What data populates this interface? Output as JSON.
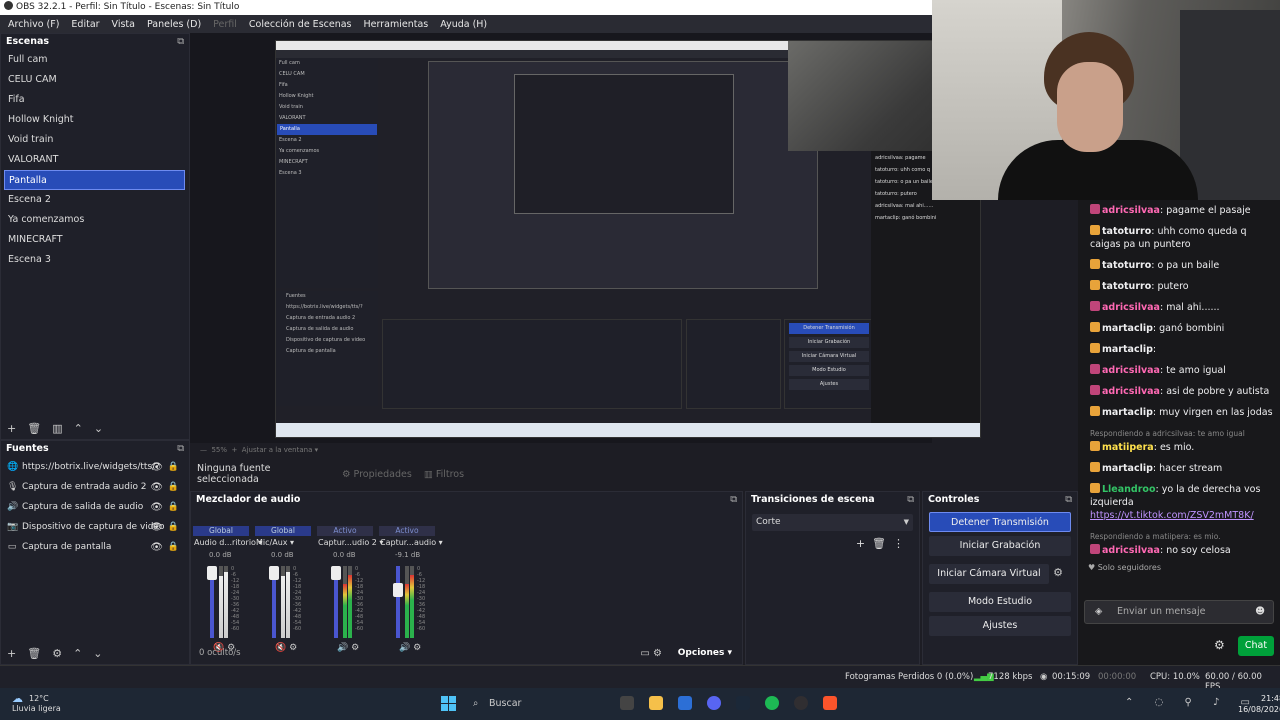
{
  "window": {
    "title": "OBS 32.2.1 - Perfil: Sin Título - Escenas: Sin Título"
  },
  "menu": [
    {
      "label": "Archivo (F)",
      "enabled": true
    },
    {
      "label": "Editar",
      "enabled": true
    },
    {
      "label": "Vista",
      "enabled": true
    },
    {
      "label": "Paneles (D)",
      "enabled": true
    },
    {
      "label": "Perfil",
      "enabled": false
    },
    {
      "label": "Colección de Escenas",
      "enabled": true
    },
    {
      "label": "Herramientas",
      "enabled": true
    },
    {
      "label": "Ayuda (H)",
      "enabled": true
    }
  ],
  "scenes": {
    "title": "Escenas",
    "items": [
      "Full cam",
      "CELU CAM",
      "Fifa",
      "Hollow Knight",
      "Void train",
      "VALORANT",
      "Pantalla",
      "Escena 2",
      "Ya comenzamos",
      "MINECRAFT",
      "Escena 3"
    ],
    "selected": "Pantalla"
  },
  "sources": {
    "title": "Fuentes",
    "items": [
      {
        "label": "https://botrix.live/widgets/tts/?",
        "icon": "globe-icon"
      },
      {
        "label": "Captura de entrada audio 2",
        "icon": "microphone-icon"
      },
      {
        "label": "Captura de salida de audio",
        "icon": "speaker-icon"
      },
      {
        "label": "Dispositivo de captura de video",
        "icon": "camera-icon"
      },
      {
        "label": "Captura de pantalla",
        "icon": "monitor-icon"
      }
    ]
  },
  "preview": {
    "scale_label": "Ajustar a la ventana"
  },
  "context_bar": {
    "no_source": "Ninguna fuente seleccionada",
    "properties": "Propiedades",
    "filters": "Filtros"
  },
  "mixer": {
    "title": "Mezclador de audio",
    "channels": [
      {
        "tag": "Global",
        "name": "Audio d...ritorio",
        "db": "0.0 dB",
        "level": 1.0,
        "muted": true,
        "active": false
      },
      {
        "tag": "Global",
        "name": "Mic/Aux",
        "db": "0.0 dB",
        "level": 1.0,
        "muted": true,
        "active": false
      },
      {
        "tag": "Activo",
        "name": "Captur...udio 2",
        "db": "0.0 dB",
        "level": 1.0,
        "muted": false,
        "active": true
      },
      {
        "tag": "Activo",
        "name": "Captur...audio",
        "db": "-9.1 dB",
        "level": 0.72,
        "muted": false,
        "active": true
      }
    ],
    "scale": [
      "0",
      "-6",
      "-12",
      "-18",
      "-24",
      "-30",
      "-36",
      "-42",
      "-48",
      "-54",
      "-60"
    ],
    "hidden": "0 oculto/s",
    "options": "Opciones"
  },
  "transitions": {
    "title": "Transiciones de escena",
    "selected": "Corte"
  },
  "controls": {
    "title": "Controles",
    "buttons": [
      "Detener Transmisión",
      "Iniciar Grabación",
      "Iniciar Cámara Virtual",
      "Modo Estudio",
      "Ajustes"
    ]
  },
  "chat": {
    "messages": [
      {
        "user": "adricsilvaa",
        "color": "#ff69b4",
        "text": "pagame el pasaje"
      },
      {
        "user": "tatoturro",
        "color": "#efeff1",
        "text": "uhh como queda q caigas pa un puntero"
      },
      {
        "user": "tatoturro",
        "color": "#efeff1",
        "text": "o pa un baile"
      },
      {
        "user": "tatoturro",
        "color": "#efeff1",
        "text": "putero"
      },
      {
        "user": "adricsilvaa",
        "color": "#ff69b4",
        "text": "mal ahi......"
      },
      {
        "user": "martaclip",
        "color": "#efeff1",
        "text": "ganó bombini"
      },
      {
        "user": "martaclip",
        "color": "#efeff1",
        "text": ""
      },
      {
        "user": "adricsilvaa",
        "color": "#ff69b4",
        "text": "te amo igual"
      },
      {
        "user": "adricsilvaa",
        "color": "#ff69b4",
        "text": "asi de pobre y autista"
      },
      {
        "user": "martaclip",
        "color": "#efeff1",
        "text": "muy virgen en las jodas"
      }
    ],
    "reply1": "Respondiendo a adricsilvaa: te amo igual",
    "msg_matipera_1": {
      "user": "matiipera",
      "color": "#ffe14d",
      "text": "es mio."
    },
    "msg_martaclip_stream": {
      "user": "martaclip",
      "color": "#efeff1",
      "text": "hacer stream"
    },
    "msg_lleandroo": {
      "user": "Lleandroo",
      "color": "#33c466",
      "text": "yo la de derecha vos izquierda",
      "link": "https://vt.tiktok.com/ZSV2mMT8K/"
    },
    "reply2": "Respondiendo a matiipera: es mio.",
    "msg_last": {
      "user": "adricsilvaa",
      "color": "#ff69b4",
      "text": "no soy celosa"
    },
    "followers_only": "Solo seguidores",
    "input_placeholder": "Enviar un mensaje",
    "send": "Chat"
  },
  "status": {
    "dropped": "Fotogramas Perdidos 0 (0.0%)",
    "bitrate": "7128 kbps",
    "stream_time": "00:15:09",
    "rec_time": "00:00:00",
    "cpu": "CPU: 10.0%",
    "fps": "60.00 / 60.00 FPS"
  },
  "taskbar": {
    "weather_temp": "12°C",
    "weather_desc": "Lluvia ligera",
    "search": "Buscar",
    "time": "21:48",
    "date": "16/08/2026"
  }
}
